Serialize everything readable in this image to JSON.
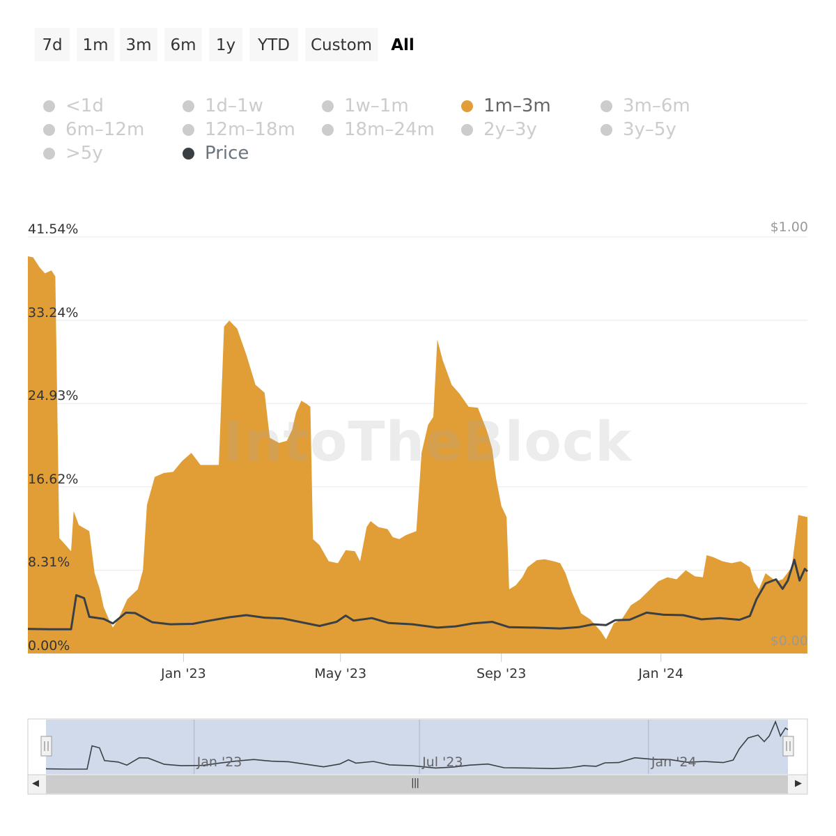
{
  "range_selector": {
    "buttons": [
      "7d",
      "1m",
      "3m",
      "6m",
      "1y",
      "YTD",
      "Custom",
      "All"
    ],
    "active": "All"
  },
  "legend": [
    {
      "label": "<1d",
      "color": "#cccccc",
      "visible": false
    },
    {
      "label": "1d–1w",
      "color": "#cccccc",
      "visible": false
    },
    {
      "label": "1w–1m",
      "color": "#cccccc",
      "visible": false
    },
    {
      "label": "1m–3m",
      "color": "#e19e36",
      "visible": true
    },
    {
      "label": "3m–6m",
      "color": "#cccccc",
      "visible": false
    },
    {
      "label": "6m–12m",
      "color": "#cccccc",
      "visible": false
    },
    {
      "label": "12m–18m",
      "color": "#cccccc",
      "visible": false
    },
    {
      "label": "18m–24m",
      "color": "#cccccc",
      "visible": false
    },
    {
      "label": "2y–3y",
      "color": "#cccccc",
      "visible": false
    },
    {
      "label": "3y–5y",
      "color": "#cccccc",
      "visible": false
    },
    {
      "label": ">5y",
      "color": "#cccccc",
      "visible": false
    },
    {
      "label": "Price",
      "color": "#3a3f44",
      "visible": true
    }
  ],
  "watermark": "IntoTheBlock",
  "chart_data": {
    "type": "area",
    "y_axis_left": {
      "ticks": [
        "0.00%",
        "8.31%",
        "16.62%",
        "24.93%",
        "33.24%",
        "41.54%"
      ],
      "range": [
        0,
        41.54
      ]
    },
    "y_axis_right": {
      "ticks": [
        "$0.00",
        "$1.00"
      ],
      "range": [
        0,
        1
      ]
    },
    "x_axis": {
      "ticks": [
        "Jan '23",
        "May '23",
        "Sep '23",
        "Jan '24"
      ],
      "range": [
        "2022-09-04",
        "2024-04-22"
      ]
    },
    "series": [
      {
        "name": "1m–3m",
        "color": "#e19e36",
        "axis": "left",
        "points": [
          [
            "2022-09-04",
            39.6
          ],
          [
            "2022-09-08",
            39.5
          ],
          [
            "2022-09-13",
            38.5
          ],
          [
            "2022-09-17",
            37.9
          ],
          [
            "2022-09-22",
            38.2
          ],
          [
            "2022-09-25",
            37.6
          ],
          [
            "2022-09-28",
            11.5
          ],
          [
            "2022-10-03",
            10.8
          ],
          [
            "2022-10-07",
            10.2
          ],
          [
            "2022-10-09",
            14.2
          ],
          [
            "2022-10-13",
            12.8
          ],
          [
            "2022-10-21",
            12.2
          ],
          [
            "2022-10-25",
            8.0
          ],
          [
            "2022-10-29",
            6.4
          ],
          [
            "2022-11-01",
            4.6
          ],
          [
            "2022-11-05",
            3.4
          ],
          [
            "2022-11-08",
            2.6
          ],
          [
            "2022-11-12",
            3.4
          ],
          [
            "2022-11-19",
            5.4
          ],
          [
            "2022-11-27",
            6.4
          ],
          [
            "2022-12-01",
            8.3
          ],
          [
            "2022-12-04",
            14.8
          ],
          [
            "2022-12-10",
            17.6
          ],
          [
            "2022-12-17",
            18.0
          ],
          [
            "2022-12-24",
            18.1
          ],
          [
            "2022-12-31",
            19.2
          ],
          [
            "2023-01-07",
            20.0
          ],
          [
            "2023-01-14",
            18.8
          ],
          [
            "2023-01-21",
            18.8
          ],
          [
            "2023-01-28",
            18.8
          ],
          [
            "2023-02-01",
            32.6
          ],
          [
            "2023-02-05",
            33.2
          ],
          [
            "2023-02-11",
            32.4
          ],
          [
            "2023-02-18",
            29.8
          ],
          [
            "2023-02-25",
            26.8
          ],
          [
            "2023-03-04",
            26.0
          ],
          [
            "2023-03-08",
            21.5
          ],
          [
            "2023-03-15",
            21.0
          ],
          [
            "2023-03-21",
            21.2
          ],
          [
            "2023-03-25",
            22.3
          ],
          [
            "2023-03-28",
            24.0
          ],
          [
            "2023-04-01",
            25.2
          ],
          [
            "2023-04-05",
            24.9
          ],
          [
            "2023-04-08",
            24.6
          ],
          [
            "2023-04-10",
            11.4
          ],
          [
            "2023-04-15",
            10.8
          ],
          [
            "2023-04-22",
            9.2
          ],
          [
            "2023-04-29",
            9.0
          ],
          [
            "2023-05-05",
            10.3
          ],
          [
            "2023-05-12",
            10.2
          ],
          [
            "2023-05-16",
            9.2
          ],
          [
            "2023-05-21",
            12.6
          ],
          [
            "2023-05-24",
            13.2
          ],
          [
            "2023-05-30",
            12.6
          ],
          [
            "2023-06-06",
            12.4
          ],
          [
            "2023-06-10",
            11.6
          ],
          [
            "2023-06-15",
            11.4
          ],
          [
            "2023-06-20",
            11.8
          ],
          [
            "2023-06-28",
            12.2
          ],
          [
            "2023-07-02",
            20.0
          ],
          [
            "2023-07-07",
            22.8
          ],
          [
            "2023-07-11",
            23.6
          ],
          [
            "2023-07-14",
            31.3
          ],
          [
            "2023-07-18",
            29.3
          ],
          [
            "2023-07-25",
            26.8
          ],
          [
            "2023-07-31",
            25.9
          ],
          [
            "2023-08-07",
            24.6
          ],
          [
            "2023-08-14",
            24.5
          ],
          [
            "2023-08-21",
            22.2
          ],
          [
            "2023-08-25",
            20.4
          ],
          [
            "2023-08-28",
            17.4
          ],
          [
            "2023-09-01",
            14.7
          ],
          [
            "2023-09-05",
            13.6
          ],
          [
            "2023-09-07",
            6.4
          ],
          [
            "2023-09-12",
            6.8
          ],
          [
            "2023-09-17",
            7.6
          ],
          [
            "2023-09-21",
            8.6
          ],
          [
            "2023-09-28",
            9.3
          ],
          [
            "2023-10-04",
            9.4
          ],
          [
            "2023-10-11",
            9.2
          ],
          [
            "2023-10-16",
            9.0
          ],
          [
            "2023-10-20",
            8.0
          ],
          [
            "2023-10-25",
            6.1
          ],
          [
            "2023-11-01",
            4.0
          ],
          [
            "2023-11-08",
            3.4
          ],
          [
            "2023-11-16",
            2.2
          ],
          [
            "2023-11-20",
            1.4
          ],
          [
            "2023-11-26",
            3.0
          ],
          [
            "2023-12-02",
            3.4
          ],
          [
            "2023-12-09",
            4.8
          ],
          [
            "2023-12-16",
            5.4
          ],
          [
            "2023-12-23",
            6.3
          ],
          [
            "2023-12-30",
            7.2
          ],
          [
            "2024-01-06",
            7.6
          ],
          [
            "2024-01-13",
            7.4
          ],
          [
            "2024-01-20",
            8.3
          ],
          [
            "2024-01-27",
            7.7
          ],
          [
            "2024-02-02",
            7.6
          ],
          [
            "2024-02-05",
            9.8
          ],
          [
            "2024-02-10",
            9.6
          ],
          [
            "2024-02-17",
            9.2
          ],
          [
            "2024-02-24",
            9.0
          ],
          [
            "2024-03-02",
            9.2
          ],
          [
            "2024-03-09",
            8.6
          ],
          [
            "2024-03-12",
            7.2
          ],
          [
            "2024-03-16",
            6.4
          ],
          [
            "2024-03-21",
            8.0
          ],
          [
            "2024-03-29",
            7.2
          ],
          [
            "2024-04-03",
            7.4
          ],
          [
            "2024-04-10",
            8.6
          ],
          [
            "2024-04-15",
            13.8
          ],
          [
            "2024-04-22",
            13.6
          ]
        ]
      },
      {
        "name": "Price",
        "color": "#3a3f44",
        "axis": "right",
        "points": [
          [
            "2022-09-04",
            0.059
          ],
          [
            "2022-09-21",
            0.058
          ],
          [
            "2022-10-07",
            0.058
          ],
          [
            "2022-10-11",
            0.14
          ],
          [
            "2022-10-17",
            0.133
          ],
          [
            "2022-10-21",
            0.088
          ],
          [
            "2022-11-01",
            0.083
          ],
          [
            "2022-11-08",
            0.072
          ],
          [
            "2022-11-18",
            0.098
          ],
          [
            "2022-11-25",
            0.097
          ],
          [
            "2022-12-08",
            0.075
          ],
          [
            "2022-12-22",
            0.07
          ],
          [
            "2023-01-08",
            0.071
          ],
          [
            "2023-01-21",
            0.079
          ],
          [
            "2023-02-05",
            0.087
          ],
          [
            "2023-02-18",
            0.092
          ],
          [
            "2023-03-04",
            0.086
          ],
          [
            "2023-03-18",
            0.084
          ],
          [
            "2023-04-01",
            0.075
          ],
          [
            "2023-04-15",
            0.066
          ],
          [
            "2023-04-28",
            0.076
          ],
          [
            "2023-05-05",
            0.091
          ],
          [
            "2023-05-11",
            0.079
          ],
          [
            "2023-05-25",
            0.085
          ],
          [
            "2023-06-07",
            0.073
          ],
          [
            "2023-06-25",
            0.07
          ],
          [
            "2023-07-14",
            0.062
          ],
          [
            "2023-07-28",
            0.065
          ],
          [
            "2023-08-10",
            0.072
          ],
          [
            "2023-08-25",
            0.076
          ],
          [
            "2023-09-07",
            0.063
          ],
          [
            "2023-09-26",
            0.062
          ],
          [
            "2023-10-16",
            0.06
          ],
          [
            "2023-10-30",
            0.063
          ],
          [
            "2023-11-10",
            0.07
          ],
          [
            "2023-11-20",
            0.068
          ],
          [
            "2023-11-27",
            0.08
          ],
          [
            "2023-12-08",
            0.081
          ],
          [
            "2023-12-21",
            0.098
          ],
          [
            "2024-01-03",
            0.093
          ],
          [
            "2024-01-18",
            0.092
          ],
          [
            "2024-02-01",
            0.082
          ],
          [
            "2024-02-15",
            0.085
          ],
          [
            "2024-03-01",
            0.081
          ],
          [
            "2024-03-09",
            0.09
          ],
          [
            "2024-03-14",
            0.13
          ],
          [
            "2024-03-21",
            0.168
          ],
          [
            "2024-03-29",
            0.178
          ],
          [
            "2024-04-03",
            0.155
          ],
          [
            "2024-04-07",
            0.175
          ],
          [
            "2024-04-12",
            0.225
          ],
          [
            "2024-04-16",
            0.175
          ],
          [
            "2024-04-20",
            0.203
          ],
          [
            "2024-04-22",
            0.197
          ]
        ]
      }
    ],
    "grid": true,
    "legend_position": "top-left"
  },
  "navigator": {
    "labels": [
      "Jan '23",
      "Jul '23",
      "Jan '24"
    ],
    "range": [
      "2022-09-04",
      "2024-04-22"
    ],
    "scrollbar_grip": "|||",
    "left_arrow": "◀",
    "right_arrow": "▶"
  }
}
